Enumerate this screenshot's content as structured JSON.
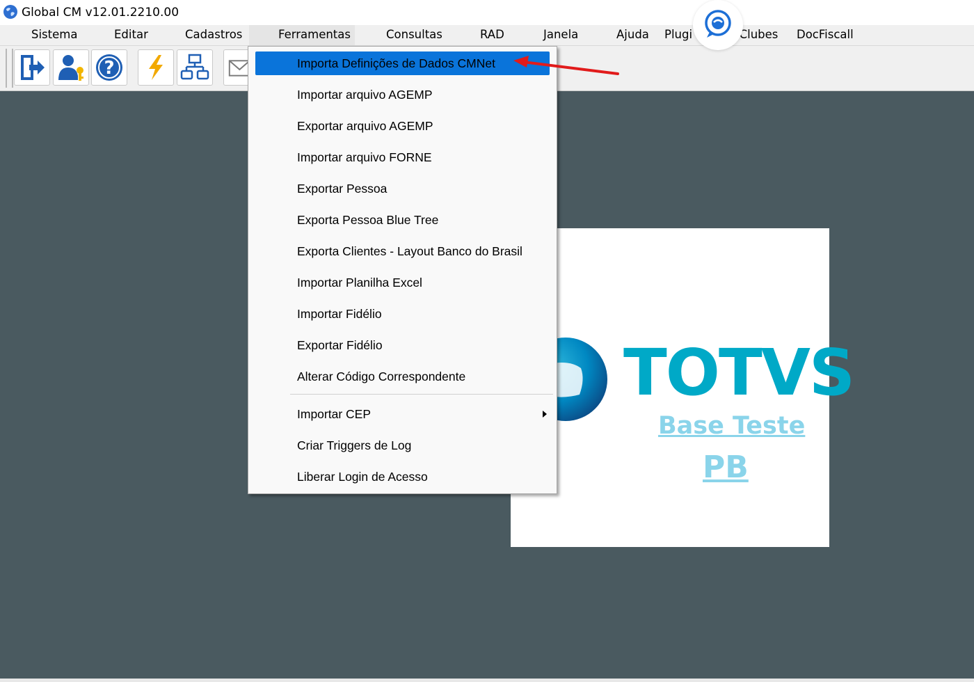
{
  "window": {
    "title": "Global CM v12.01.2210.00",
    "app_icon": "globe-icon"
  },
  "menubar": {
    "items": [
      {
        "label": "Sistema"
      },
      {
        "label": "Editar"
      },
      {
        "label": "Cadastros"
      },
      {
        "label": "Ferramentas",
        "active": true
      },
      {
        "label": "Consultas"
      },
      {
        "label": "RAD"
      },
      {
        "label": "Janela"
      },
      {
        "label": "Ajuda"
      },
      {
        "label": "Plugi"
      },
      {
        "label": "iClubes"
      },
      {
        "label": "DocFiscall"
      }
    ]
  },
  "toolbar": {
    "buttons": [
      {
        "icon": "exit-door-icon"
      },
      {
        "icon": "user-key-icon"
      },
      {
        "icon": "help-icon"
      },
      {
        "icon": "lightning-icon"
      },
      {
        "icon": "org-chart-icon"
      },
      {
        "icon": "envelope-icon"
      }
    ]
  },
  "dropdown": {
    "items": [
      {
        "label": "Importa Definições de Dados CMNet",
        "highlighted": true
      },
      {
        "label": "Importar arquivo AGEMP"
      },
      {
        "label": "Exportar arquivo AGEMP"
      },
      {
        "label": "Importar arquivo FORNE"
      },
      {
        "label": "Exportar Pessoa"
      },
      {
        "label": "Exporta Pessoa Blue Tree"
      },
      {
        "label": "Exporta Clientes - Layout Banco do Brasil"
      },
      {
        "label": "Importar Planilha Excel"
      },
      {
        "label": "Importar Fidélio"
      },
      {
        "label": "Exportar Fidélio"
      },
      {
        "label": "Alterar Código Correspondente"
      },
      {
        "label": "Importar CEP",
        "submenu": true
      },
      {
        "label": "Criar Triggers de Log"
      },
      {
        "label": "Liberar Login de Acesso"
      }
    ]
  },
  "logo": {
    "brand": "TOTVS",
    "line1": "Base Teste",
    "line2": "PB"
  },
  "colors": {
    "workspace": "#4a5a60",
    "highlight": "#0a74da",
    "brand": "#00a9c7",
    "annotation": "#e11b1b"
  }
}
